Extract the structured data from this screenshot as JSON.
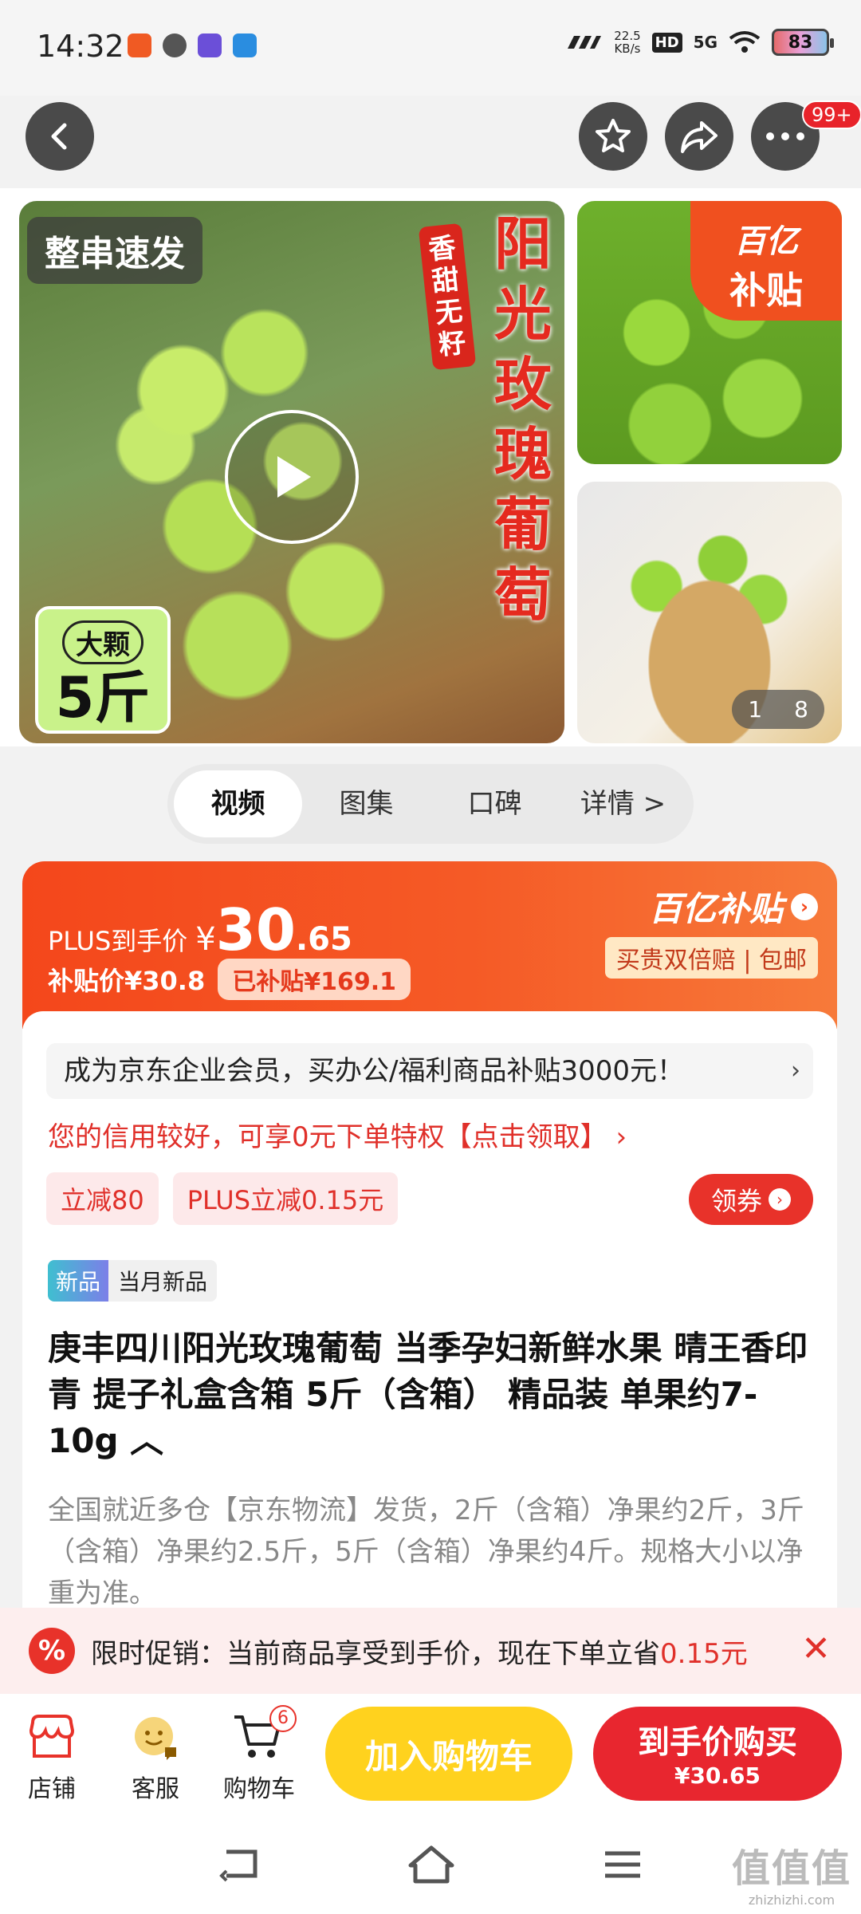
{
  "status_bar": {
    "time": "14:32",
    "net_speed_value": "22.5",
    "net_speed_unit": "KB/s",
    "hd_label": "HD",
    "network": "5G",
    "battery": "83"
  },
  "header": {
    "more_badge": "99+"
  },
  "gallery": {
    "main_tag": "整串速发",
    "vertical_title": "阳光玫瑰葡萄",
    "vertical_sub": "香甜无籽",
    "size_tag_small": "大颗",
    "size_tag_big": "5斤",
    "subsidy_line1": "百亿",
    "subsidy_line2": "补贴",
    "counter_current": "1",
    "counter_total": "8"
  },
  "tabs": [
    {
      "label": "视频",
      "active": true
    },
    {
      "label": "图集"
    },
    {
      "label": "口碑"
    },
    {
      "label": "详情 >"
    }
  ],
  "price": {
    "plus_label": "PLUS到手价",
    "currency": "¥",
    "integer": "30",
    "decimal": ".65",
    "subsidy_price": "补贴价¥30.8",
    "subsidized": "已补贴¥169.1",
    "brand": "百亿补贴",
    "brand_sub": "买贵双倍赔 | 包邮"
  },
  "detail": {
    "enterprise_text": "成为京东企业会员，买办公/福利商品补贴3000元！",
    "enterprise_chev": "›",
    "credit_text": "您的信用较好，可享0元下单特权【点击领取】 ›",
    "coupons": [
      "立减80",
      "PLUS立减0.15元"
    ],
    "get_coupon": "领券",
    "tag_new": "新品",
    "tag_month": "当月新品",
    "title": "庚丰四川阳光玫瑰葡萄 当季孕妇新鲜水果 晴王香印青 提子礼盒含箱 5斤（含箱） 精品装 单果约7-10g ︿",
    "description": "全国就近多仓【京东物流】发货，2斤（含箱）净果约2斤，3斤（含箱）净果约2.5斤，5斤（含箱）净果约4斤。规格大小以净重为准。"
  },
  "promo": {
    "icon": "%",
    "text_prefix": "限时促销：当前商品享受到手价，现在下单立省",
    "text_highlight": "0.15元",
    "close": "✕"
  },
  "action_bar": {
    "store": "店铺",
    "service": "客服",
    "cart": "购物车",
    "cart_count": "6",
    "add_to_cart": "加入购物车",
    "buy_line1": "到手价购买",
    "buy_line2": "¥30.65"
  },
  "watermark": {
    "logo": "值值值",
    "url": "zhizhizhi.com"
  },
  "colors": {
    "accent_red": "#e8262f",
    "brand_orange": "#f4471b",
    "cart_yellow": "#ffd21e"
  }
}
